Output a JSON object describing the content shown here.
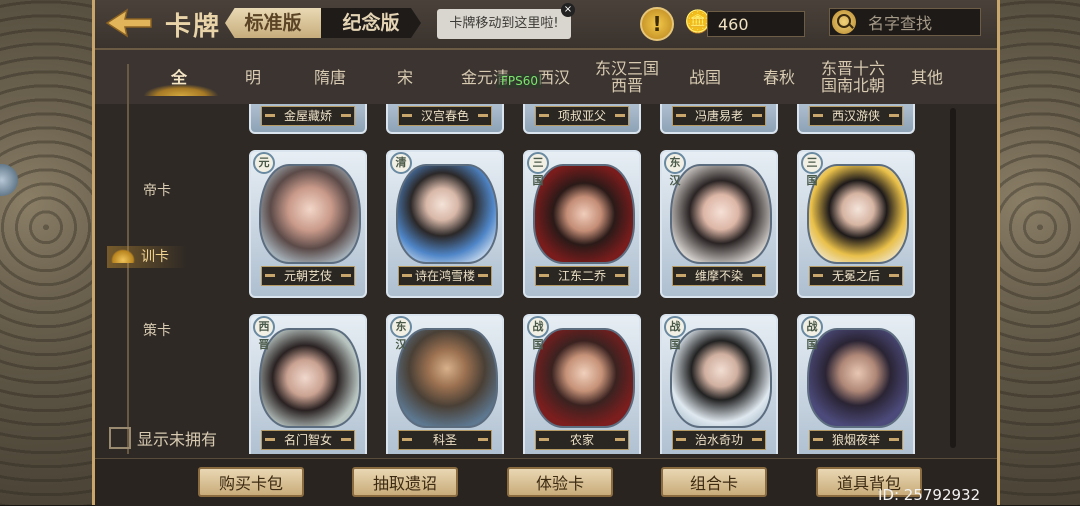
{
  "header": {
    "title": "卡牌",
    "tab_standard": "标准版",
    "tab_memorial": "纪念版",
    "tip": "卡牌移动到这里啦!",
    "tip_close": "×",
    "coin_count": "460",
    "search_placeholder": "名字查找",
    "warning_icon": "exclamation-icon"
  },
  "eras": [
    "全",
    "明",
    "隋唐",
    "宋",
    "金元清",
    "西汉",
    "东汉三国\n西晋",
    "战国",
    "春秋",
    "东晋十六\n国南北朝",
    "其他"
  ],
  "fps": "FPS60",
  "sidebar": {
    "items": [
      "帝卡",
      "训卡",
      "策卡"
    ],
    "active": "训卡",
    "show_unowned": "显示未拥有"
  },
  "cards_top": [
    "金屋藏娇",
    "汉宫春色",
    "项叔亚父",
    "冯唐易老",
    "西汉游侠"
  ],
  "cards_mid": [
    {
      "name": "元朝艺伎",
      "era": "元"
    },
    {
      "name": "诗在鸿雪楼",
      "era": "清"
    },
    {
      "name": "江东二乔",
      "era": "三国"
    },
    {
      "name": "维摩不染",
      "era": "东汉"
    },
    {
      "name": "无冕之后",
      "era": "三国"
    }
  ],
  "cards_bot": [
    {
      "name": "名门智女",
      "era": "西晋"
    },
    {
      "name": "科圣",
      "era": "东汉"
    },
    {
      "name": "农家",
      "era": "战国"
    },
    {
      "name": "治水奇功",
      "era": "战国"
    },
    {
      "name": "狼烟夜举",
      "era": "战国"
    }
  ],
  "buttons": [
    "购买卡包",
    "抽取遗诏",
    "体验卡",
    "组合卡",
    "道具背包"
  ],
  "uid": "ID: 25792932"
}
